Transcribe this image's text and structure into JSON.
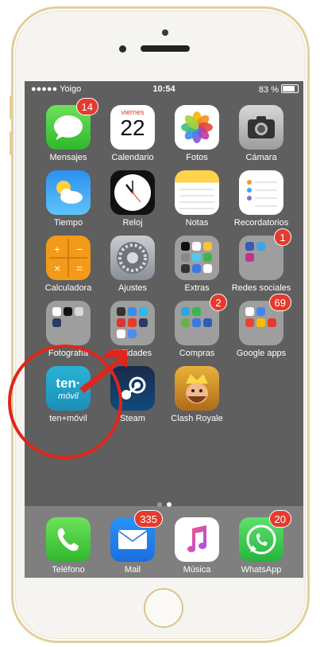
{
  "status": {
    "carrier": "●●●●● Yoigo",
    "time": "10:54",
    "battery": "83 %"
  },
  "calendar": {
    "weekday": "viernes",
    "day": "22"
  },
  "home": {
    "rows": [
      [
        {
          "label": "Mensajes",
          "badge": "14"
        },
        {
          "label": "Calendario"
        },
        {
          "label": "Fotos"
        },
        {
          "label": "Cámara"
        }
      ],
      [
        {
          "label": "Tiempo"
        },
        {
          "label": "Reloj"
        },
        {
          "label": "Notas"
        },
        {
          "label": "Recordatorios"
        }
      ],
      [
        {
          "label": "Calculadora"
        },
        {
          "label": "Ajustes"
        },
        {
          "label": "Extras"
        },
        {
          "label": "Redes sociales",
          "badge": "1"
        }
      ],
      [
        {
          "label": "Fotografía"
        },
        {
          "label": "Utilidades"
        },
        {
          "label": "Compras",
          "badge": "2"
        },
        {
          "label": "Google apps",
          "badge": "69"
        }
      ],
      [
        {
          "label": "ten+móvil",
          "icon_text": "ten·",
          "icon_subtext": "móvil"
        },
        {
          "label": "Steam"
        },
        {
          "label": "Clash Royale"
        }
      ]
    ]
  },
  "dock": [
    {
      "label": "Teléfono"
    },
    {
      "label": "Mail",
      "badge": "335"
    },
    {
      "label": "Música"
    },
    {
      "label": "WhatsApp",
      "badge": "20"
    }
  ],
  "colors": {
    "highlight_circle": "#e0251b",
    "badge": "#e53a2c",
    "screen_bg": "#5f5f5f"
  }
}
